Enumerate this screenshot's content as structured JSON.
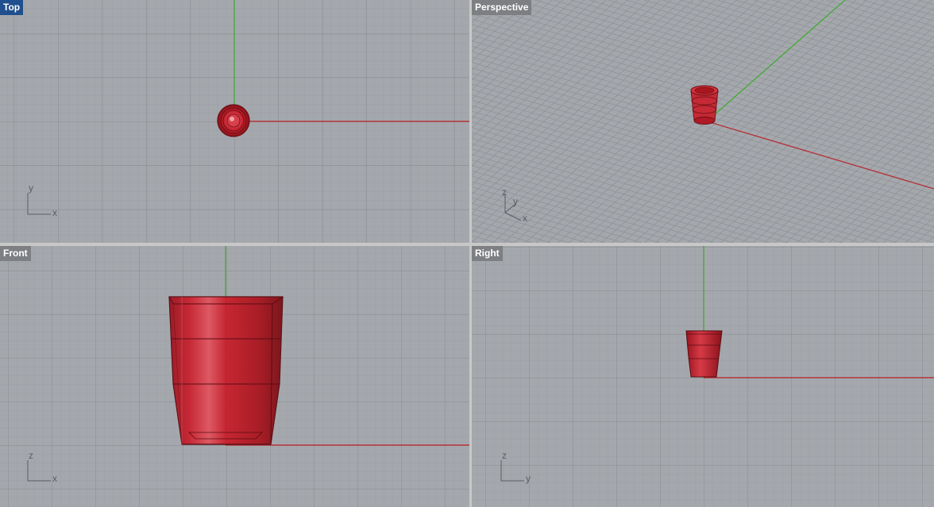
{
  "viewports": {
    "top": {
      "title": "Top",
      "axis_x": "x",
      "axis_y": "y"
    },
    "perspective": {
      "title": "Perspective",
      "axis_x": "x",
      "axis_y": "y",
      "axis_z": "z"
    },
    "front": {
      "title": "Front",
      "axis_x": "x",
      "axis_y": "z"
    },
    "right": {
      "title": "Right",
      "axis_x": "y",
      "axis_y": "z"
    }
  },
  "colors": {
    "viewport_bg": "#a4a8ad",
    "grid_minor": "#9a9ea3",
    "grid_major": "#8a8e93",
    "x_axis": "#b3343a",
    "y_axis": "#4aa83a",
    "object_fill": "#c8202c",
    "object_edge": "#6a0e14",
    "active_title": "#1f4f8d",
    "inactive_title": "#7d7f83"
  }
}
